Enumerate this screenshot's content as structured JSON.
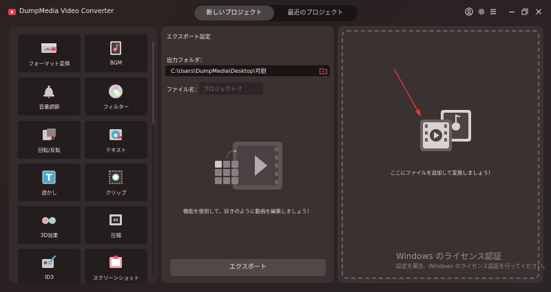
{
  "app": {
    "title": "DumpMedia Video Converter",
    "brand_color": "#e83a4e"
  },
  "tabs": [
    {
      "label": "新しいプロジェクト",
      "active": true
    },
    {
      "label": "最近のプロジェクト",
      "active": false
    }
  ],
  "window_controls": [
    "user-icon",
    "gear-icon",
    "menu-icon",
    "minimize-icon",
    "restore-icon",
    "close-icon"
  ],
  "tools": [
    {
      "label": "フォーマット変換",
      "icon": "format-convert-icon"
    },
    {
      "label": "BGM",
      "icon": "music-icon"
    },
    {
      "label": "音量調節",
      "icon": "volume-icon"
    },
    {
      "label": "フィルター",
      "icon": "filter-icon"
    },
    {
      "label": "回転/反転",
      "icon": "rotate-icon"
    },
    {
      "label": "テキスト",
      "icon": "text-icon"
    },
    {
      "label": "透かし",
      "icon": "watermark-icon"
    },
    {
      "label": "クリップ",
      "icon": "crop-icon"
    },
    {
      "label": "3D効果",
      "icon": "3d-glasses-icon"
    },
    {
      "label": "圧縮",
      "icon": "compress-icon"
    },
    {
      "label": "ID3",
      "icon": "id3-icon"
    },
    {
      "label": "スクリーンショット",
      "icon": "screenshot-icon"
    }
  ],
  "export_settings": {
    "heading": "エクスポート設定",
    "folder_label": "出力フォルダ：",
    "folder_path": "C:\\Users\\DumpMedia\\Desktop\\可剧",
    "filename_label": "ファイル名：",
    "filename_placeholder": "プロジェクト-7",
    "message": "機能を使用して、好きのように動画を編集しましょう！",
    "export_button": "エクスポート"
  },
  "dropzone": {
    "message": "ここにファイルを追加して変換しましょう！"
  },
  "windows_activation": {
    "title": "Windows のライセンス認証",
    "subtitle": "設定を開き、Windows のライセンス認証を行ってください。"
  }
}
